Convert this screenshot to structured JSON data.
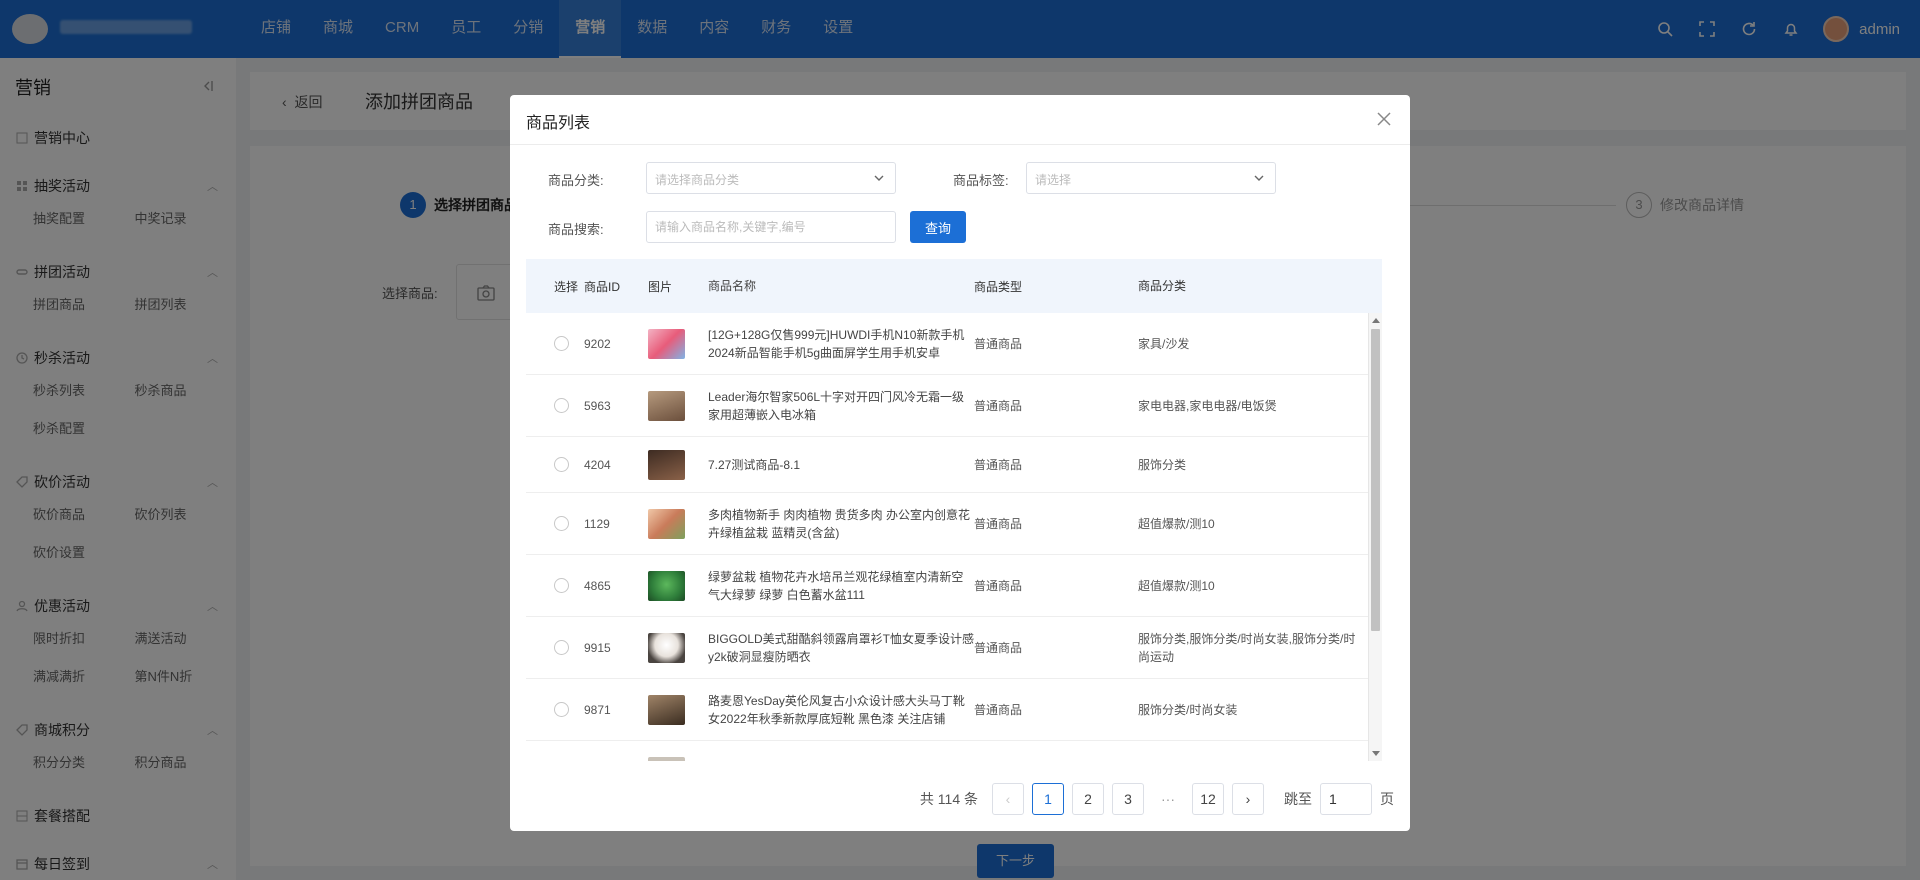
{
  "topbar": {
    "nav": [
      "店铺",
      "商城",
      "CRM",
      "员工",
      "分销",
      "营销",
      "数据",
      "内容",
      "财务",
      "设置"
    ],
    "active": "营销",
    "user": "admin"
  },
  "sidebar": {
    "title": "营销",
    "groups": [
      {
        "title": "营销中心",
        "items": []
      },
      {
        "title": "抽奖活动",
        "items": [
          "抽奖配置",
          "中奖记录"
        ]
      },
      {
        "title": "拼团活动",
        "items": [
          "拼团商品",
          "拼团列表"
        ]
      },
      {
        "title": "秒杀活动",
        "items": [
          "秒杀列表",
          "秒杀商品",
          "秒杀配置"
        ]
      },
      {
        "title": "砍价活动",
        "items": [
          "砍价商品",
          "砍价列表",
          "砍价设置"
        ]
      },
      {
        "title": "优惠活动",
        "items": [
          "限时折扣",
          "满送活动",
          "满减满折",
          "第N件N折"
        ]
      },
      {
        "title": "商城积分",
        "items": [
          "积分分类",
          "积分商品"
        ]
      },
      {
        "title": "套餐搭配",
        "items": []
      },
      {
        "title": "每日签到",
        "items": []
      }
    ]
  },
  "page": {
    "back": "返回",
    "title": "添加拼团商品",
    "step1_num": "1",
    "step1": "选择拼团商品",
    "step3_num": "3",
    "step3": "修改商品详情",
    "choose_label": "选择商品:",
    "next": "下一步"
  },
  "modal": {
    "title": "商品列表",
    "category_label": "商品分类:",
    "category_placeholder": "请选择商品分类",
    "tag_label": "商品标签:",
    "tag_placeholder": "请选择",
    "search_label": "商品搜索:",
    "search_placeholder": "请输入商品名称,关键字,编号",
    "query": "查询",
    "columns": [
      "选择",
      "商品ID",
      "图片",
      "商品名称",
      "商品类型",
      "商品分类"
    ],
    "rows": [
      {
        "id": "9202",
        "name": "[12G+128G仅售999元]HUWDI手机N10新款手机2024新品智能手机5g曲面屏学生用手机安卓",
        "type": "普通商品",
        "category": "家具/沙发",
        "thumb": "#e85c7a"
      },
      {
        "id": "5963",
        "name": "Leader海尔智家506L十字对开四门风冷无霜一级家用超薄嵌入电冰箱",
        "type": "普通商品",
        "category": "家电电器,家电电器/电饭煲",
        "thumb": "#8a6a52"
      },
      {
        "id": "4204",
        "name": "7.27测试商品-8.1",
        "type": "普通商品",
        "category": "服饰分类",
        "thumb": "#6b4a36"
      },
      {
        "id": "1129",
        "name": "多肉植物新手 肉肉植物 贵货多肉 办公室内创意花卉绿植盆栽 蓝精灵(含盆)",
        "type": "普通商品",
        "category": "超值爆款/测10",
        "thumb": "#c97b5a"
      },
      {
        "id": "4865",
        "name": "绿萝盆栽 植物花卉水培吊兰观花绿植室内清新空气大绿萝 绿萝 白色蓄水盆111",
        "type": "普通商品",
        "category": "超值爆款/测10",
        "thumb": "#2e7d3a"
      },
      {
        "id": "9915",
        "name": "BIGGOLD美式甜酷斜领露肩罩衫T恤女夏季设计感y2k破洞显瘦防晒衣",
        "type": "普通商品",
        "category": "服饰分类,服饰分类/时尚女装,服饰分类/时尚运动",
        "thumb": "#e8e2dc"
      },
      {
        "id": "9871",
        "name": "路麦恩YesDay英伦风复古小众设计感大头马丁靴女2022年秋季新款厚底短靴 黑色漆 关注店铺",
        "type": "普通商品",
        "category": "服饰分类/时尚女装",
        "thumb": "#5a4634"
      }
    ],
    "total_text": "共 114 条",
    "pages": [
      "1",
      "2",
      "3",
      "···",
      "12"
    ],
    "current_page": "1",
    "goto_label": "跳至",
    "goto_value": "1",
    "goto_suffix": "页"
  }
}
